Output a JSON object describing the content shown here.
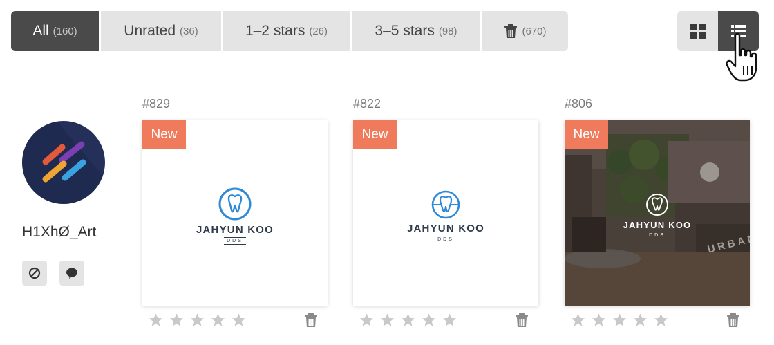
{
  "filters": [
    {
      "label": "All",
      "count": "(160)",
      "active": true
    },
    {
      "label": "Unrated",
      "count": "(36)"
    },
    {
      "label": "1–2 stars",
      "count": "(26)"
    },
    {
      "label": "3–5 stars",
      "count": "(98)"
    },
    {
      "label": "",
      "count": "(670)",
      "icon": "trash-icon"
    }
  ],
  "view_toggle": {
    "grid_icon": "grid-icon",
    "list_icon": "list-icon",
    "active": "list"
  },
  "designer": {
    "name": "H1XhØ_Art",
    "avatar_colors": [
      "#e25a3a",
      "#7b3fb3",
      "#f0a532",
      "#3aa2e0"
    ],
    "avatar_bg": "#24305a"
  },
  "entries": [
    {
      "number": "#829",
      "badge": "New",
      "logo_name": "JAHYUN KOO",
      "logo_sub": "DDS",
      "variant": "round-logo",
      "rating": 0
    },
    {
      "number": "#822",
      "badge": "New",
      "logo_name": "JAHYUN KOO",
      "logo_sub": "DDS",
      "variant": "split-logo",
      "rating": 0
    },
    {
      "number": "#806",
      "badge": "New",
      "logo_name": "JAHYUN KOO",
      "logo_sub": "DDS",
      "variant": "photo-mockup",
      "photo_sign": "URBAN",
      "rating": 0
    }
  ],
  "colors": {
    "badge": "#ef7a5c",
    "active_tab": "#4a4a4a",
    "tab": "#e4e4e4",
    "tooth_blue": "#2e8ad6",
    "star": "#c9c9c9"
  }
}
